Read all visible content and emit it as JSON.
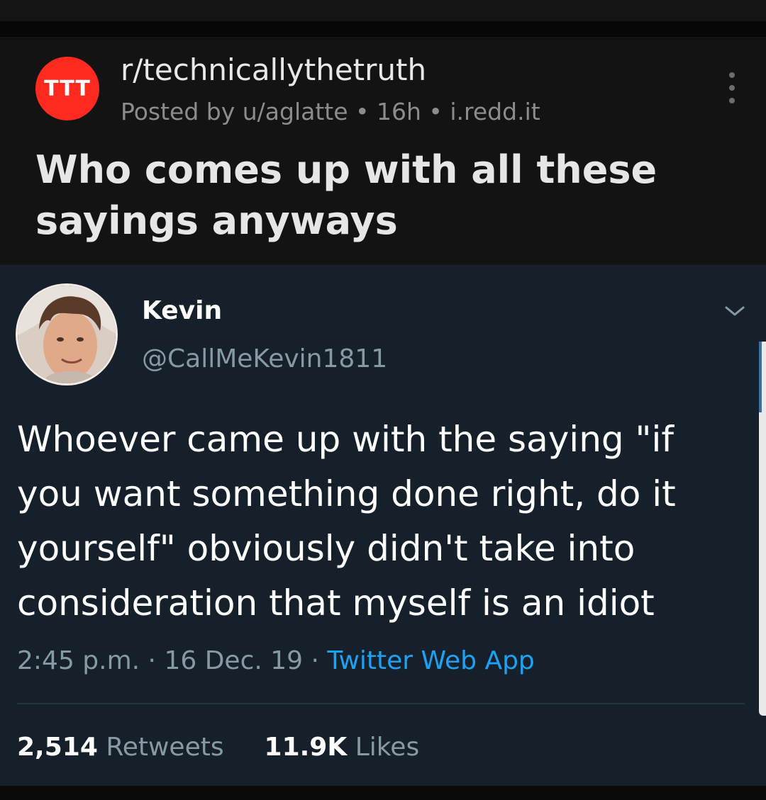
{
  "subreddit": {
    "icon_text": "TTT",
    "icon_color": "#ff2a1f",
    "name": "r/technicallythetruth"
  },
  "post": {
    "posted_by": "Posted by u/aglatte",
    "age": "16h",
    "domain": "i.redd.it",
    "separator": "•",
    "title": "Who comes up with all these sayings anyways",
    "more_icon": "more-vertical-icon"
  },
  "tweet": {
    "author_name": "Kevin",
    "author_handle": "@CallMeKevin1811",
    "caret_icon": "chevron-down-icon",
    "text": "Whoever came up with the saying \"if you want something done right, do it yourself\" obviously didn't take into consideration that myself is an idiot",
    "time": "2:45 p.m.",
    "date": "16 Dec. 19",
    "dot": "·",
    "source": "Twitter Web App",
    "source_color": "#1da1f2",
    "retweets_count": "2,514",
    "retweets_label": "Retweets",
    "likes_count": "11.9K",
    "likes_label": "Likes"
  }
}
